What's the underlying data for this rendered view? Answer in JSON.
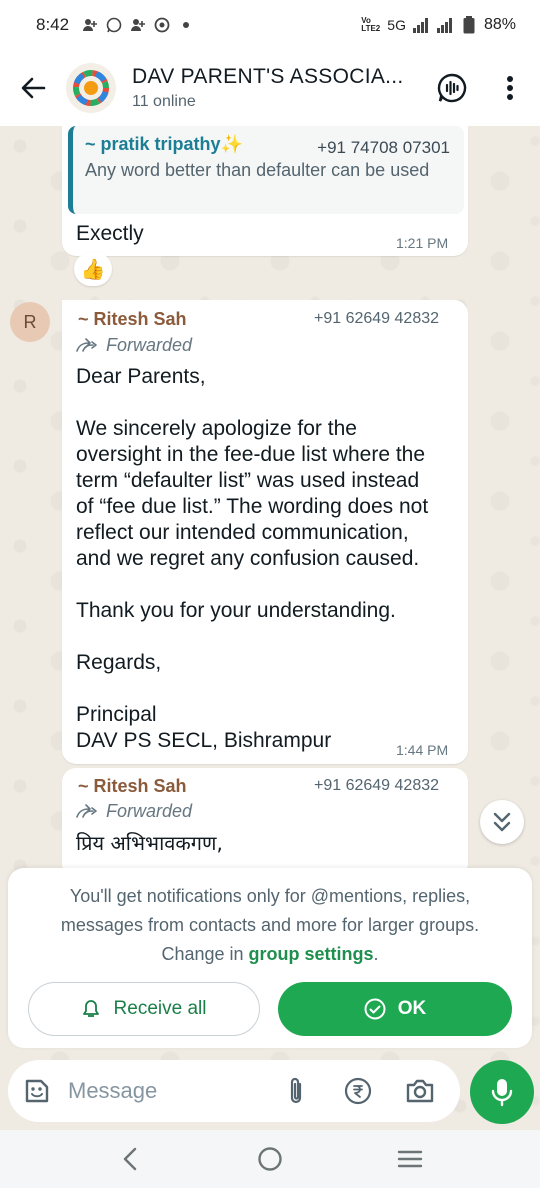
{
  "status_bar": {
    "time": "8:42",
    "network_tag": "Vo LTE2",
    "network": "5G",
    "battery": "88%"
  },
  "header": {
    "group_name": "DAV PARENT'S ASSOCIA...",
    "subtitle": "11 online"
  },
  "messages": [
    {
      "quote": {
        "name": "~ pratik tripathy✨",
        "phone": "+91 74708 07301",
        "text": "Any word better than defaulter can be used"
      },
      "text": "Exectly",
      "time": "1:21 PM",
      "reaction": "👍"
    },
    {
      "avatar_letter": "R",
      "sender": "~ Ritesh Sah",
      "phone": "+91 62649 42832",
      "forwarded_label": "Forwarded",
      "lines": [
        "Dear Parents,",
        "We sincerely apologize for the",
        "oversight in the fee-due list where the",
        "term “defaulter list” was used instead",
        "of “fee due list.” The wording does not",
        "reflect our intended communication,",
        "and we regret any confusion caused.",
        "Thank you for your understanding.",
        "Regards,",
        "Principal",
        "DAV PS SECL, Bishrampur"
      ],
      "time": "1:44 PM"
    },
    {
      "sender": "~ Ritesh Sah",
      "phone": "+91 62649 42832",
      "forwarded_label": "Forwarded",
      "text": "प्रिय अभिभावकगण,"
    }
  ],
  "notice": {
    "line1": "You'll get notifications only for @mentions, replies,",
    "line2": "messages from contacts and more for larger groups.",
    "line3_prefix": "Change in ",
    "link": "group settings",
    "line3_suffix": ".",
    "receive_all": "Receive all",
    "ok": "OK"
  },
  "composer": {
    "placeholder": "Message"
  },
  "colors": {
    "accent_green": "#1da851",
    "quote_teal": "#1b7e95",
    "sender_brown": "#8a5a3b"
  }
}
